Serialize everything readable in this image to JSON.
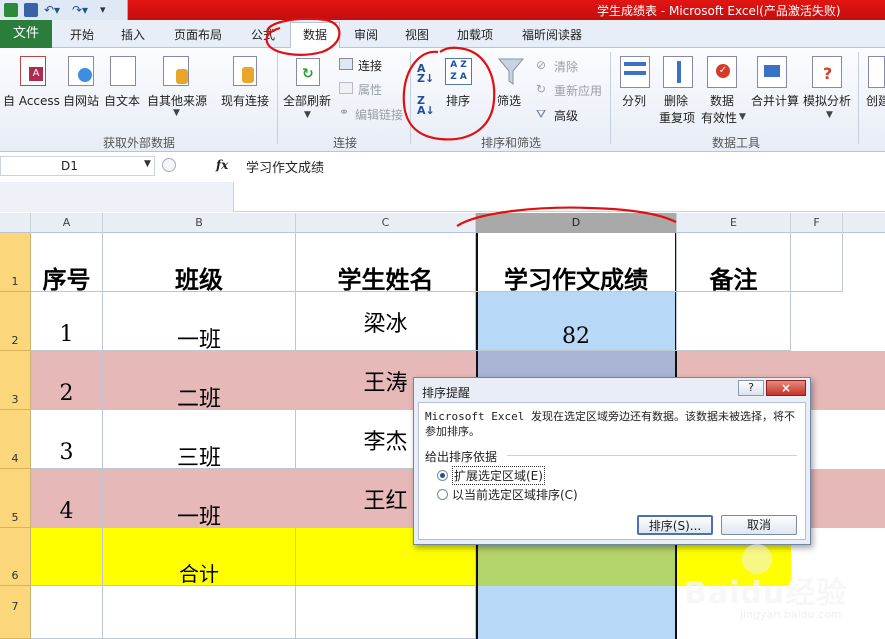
{
  "window": {
    "title": "学生成绩表 - Microsoft Excel(产品激活失败)"
  },
  "tabs": [
    "文件",
    "开始",
    "插入",
    "页面布局",
    "公式",
    "数据",
    "审阅",
    "视图",
    "加载项",
    "福昕阅读器"
  ],
  "active_tab": "数据",
  "ribbon": {
    "external_data": {
      "buttons": [
        "自 Access",
        "自网站",
        "自文本",
        "自其他来源",
        "现有连接"
      ],
      "label": "获取外部数据"
    },
    "connections": {
      "refresh_all": "全部刷新",
      "connections": "连接",
      "properties": "属性",
      "edit_links": "编辑链接",
      "label": "连接"
    },
    "sort_filter": {
      "sort": "排序",
      "filter": "筛选",
      "clear": "清除",
      "reapply": "重新应用",
      "advanced": "高级",
      "label": "排序和筛选"
    },
    "data_tools": {
      "text_to_columns": "分列",
      "remove_dup_line1": "删除",
      "remove_dup_line2": "重复项",
      "validation_line1": "数据",
      "validation_line2": "有效性",
      "consolidate": "合并计算",
      "what_if": "模拟分析",
      "create": "创建",
      "label": "数据工具"
    }
  },
  "formula_bar": {
    "name_box": "D1",
    "fx": "fx",
    "formula": "学习作文成绩"
  },
  "columns": [
    "A",
    "B",
    "C",
    "D",
    "E",
    "F"
  ],
  "rows": [
    "1",
    "2",
    "3",
    "4",
    "5",
    "6",
    "7"
  ],
  "sheet": {
    "headers": [
      "序号",
      "班级",
      "学生姓名",
      "学习作文成绩",
      "备注"
    ],
    "data": [
      {
        "no": "1",
        "class": "一班",
        "name": "梁冰",
        "score": "82"
      },
      {
        "no": "2",
        "class": "二班",
        "name": "王涛",
        "score": ""
      },
      {
        "no": "3",
        "class": "三班",
        "name": "李杰",
        "score": ""
      },
      {
        "no": "4",
        "class": "一班",
        "name": "王红",
        "score": ""
      }
    ],
    "total_label": "合计"
  },
  "dialog": {
    "title": "排序提醒",
    "help": "?",
    "close": "×",
    "message": "Microsoft Excel 发现在选定区域旁边还有数据。该数据未被选择，将不参加排序。",
    "group_label": "给出排序依据",
    "option_expand": "扩展选定区域(E)",
    "option_current": "以当前选定区域排序(C)",
    "selected_option": "扩展选定区域(E)",
    "sort_button": "排序(S)...",
    "cancel_button": "取消"
  },
  "watermark": {
    "logo": "Baidu经验",
    "url": "jingyan.baidu.com"
  },
  "colors": {
    "title_bar": "#d81513",
    "file_tab": "#2a7d3a",
    "row_pink": "#e6b9b8",
    "row_yellow": "#ffff00",
    "col_d_blue": "#b8d8f8",
    "col_d_green": "#b3d46a",
    "annotation": "#e01010"
  }
}
